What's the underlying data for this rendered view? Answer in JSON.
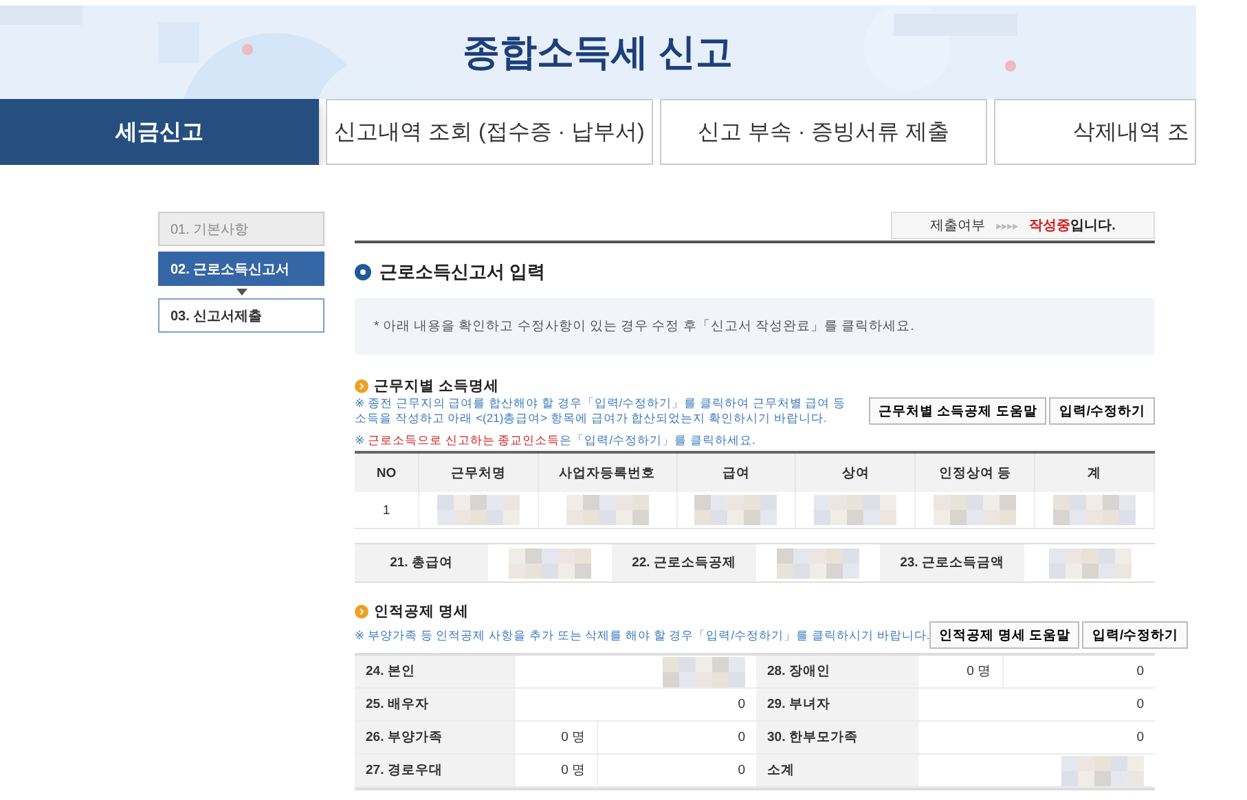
{
  "banner": {
    "title": "종합소득세 신고"
  },
  "tabs": [
    {
      "label": "세금신고",
      "selected": true
    },
    {
      "label": "신고내역 조회 (접수증 · 납부서)",
      "selected": false
    },
    {
      "label": "신고 부속 · 증빙서류 제출",
      "selected": false
    },
    {
      "label": "삭제내역 조",
      "selected": false
    }
  ],
  "steps": [
    {
      "label": "01. 기본사항",
      "selected": false,
      "disabled": true
    },
    {
      "label": "02. 근로소득신고서",
      "selected": true,
      "disabled": false
    },
    {
      "label": "03. 신고서제출",
      "selected": false,
      "disabled": false
    }
  ],
  "status": {
    "label": "제출여부",
    "arrows": "▸▸▸▸",
    "state": "작성중",
    "suffix": "입니다."
  },
  "section_title": "근로소득신고서 입력",
  "notice": "* 아래 내용을 확인하고 수정사항이 있는 경우 수정 후「신고서 작성완료」를 클릭하세요.",
  "workplace": {
    "title": "근무지별 소득명세",
    "note": "※ 종전 근무지의 급여를 합산해야 할 경우「입력/수정하기」를 클릭하여 근무처별 급여 등 소득을 작성하고 아래 <(21)총급여> 항목에 급여가 합산되었는지 확인하시기 바랍니다.",
    "note2": "※ **근로소득으로 신고하는 종교인소득**은「입력/수정하기」를 클릭하세요.",
    "buttons": [
      "근무처별 소득공제 도움말",
      "입력/수정하기"
    ],
    "columns": [
      "NO",
      "근무처명",
      "사업자등록번호",
      "급여",
      "상여",
      "인정상여 등",
      "계"
    ],
    "rows": [
      {
        "cells": [
          {
            "kind": "text",
            "text": "1"
          },
          {
            "kind": "blurred"
          },
          {
            "kind": "blurred"
          },
          {
            "kind": "blurred"
          },
          {
            "kind": "blurred"
          },
          {
            "kind": "blurred"
          },
          {
            "kind": "blurred"
          }
        ]
      }
    ],
    "totals": [
      {
        "label": "21. 총급여",
        "kind": "blurred"
      },
      {
        "label": "22. 근로소득공제",
        "kind": "blurred"
      },
      {
        "label": "23. 근로소득금액",
        "kind": "blurred"
      }
    ]
  },
  "personal": {
    "title": "인적공제 명세",
    "note": "※ 부양가족 등 인적공제 사항을 추가 또는 삭제를 해야 할 경우「입력/수정하기」를 클릭하시기 바랍니다.",
    "buttons": [
      "인적공제 명세 도움말",
      "입력/수정하기"
    ],
    "rows": [
      {
        "left": {
          "label": "24. 본인",
          "kind": "blurred"
        },
        "right": {
          "label": "28. 장애인",
          "kind": "count",
          "count": "0 명",
          "value": "0"
        }
      },
      {
        "left": {
          "label": "25. 배우자",
          "kind": "amount",
          "value": "0"
        },
        "right": {
          "label": "29. 부녀자",
          "kind": "amount",
          "value": "0"
        }
      },
      {
        "left": {
          "label": "26. 부양가족",
          "kind": "count",
          "count": "0 명",
          "value": "0"
        },
        "right": {
          "label": "30. 한부모가족",
          "kind": "amount",
          "value": "0"
        }
      },
      {
        "left": {
          "label": "27. 경로우대",
          "kind": "count",
          "count": "0 명",
          "value": "0"
        },
        "right": {
          "label": "소계",
          "kind": "blurred"
        }
      }
    ]
  }
}
